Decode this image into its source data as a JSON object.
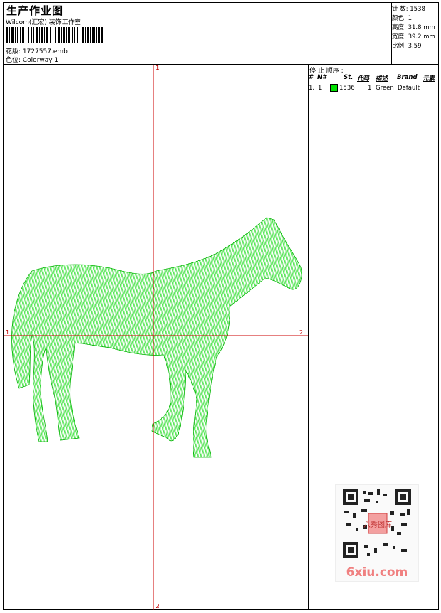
{
  "header": {
    "title": "生产作业图",
    "subtitle": "Wilcom(汇宏) 装饰工作室",
    "design_label": "花版: 1727557.emb",
    "colorway_label": "色位:  Colorway 1"
  },
  "stats": {
    "stitches": "针 数: 1538",
    "colors": "颜色: 1",
    "height": "高度: 31.8 mm",
    "width": "宽度: 39.2 mm",
    "scale": "比例: 3.59"
  },
  "stop_sequence": {
    "title": "停 止 顺序 :",
    "headers": [
      "#",
      "N#",
      "St.",
      "代码",
      "描述",
      "Brand",
      "元素"
    ],
    "rows": [
      {
        "num": "1.",
        "n": "1",
        "stitches": "1536",
        "code": "1",
        "description": "Green",
        "brand": "Default",
        "color": "#00e000"
      }
    ]
  },
  "axes": {
    "top": "1",
    "bottom": "2",
    "left": "1",
    "right": "2",
    "color": "#cc0000"
  },
  "colors": {
    "thread": "#00e000",
    "outline": "#00b400"
  },
  "watermark": {
    "text": "6xiu.com",
    "stamp_text": "六秀图库"
  }
}
